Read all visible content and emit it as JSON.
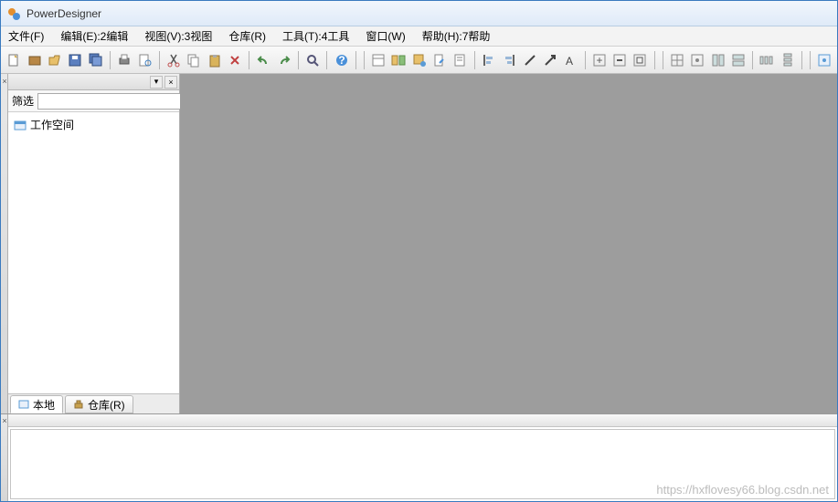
{
  "app": {
    "title": "PowerDesigner"
  },
  "menu": {
    "file": "文件(F)",
    "edit": "编辑(E):2编辑",
    "view": "视图(V):3视图",
    "repo": "仓库(R)",
    "tools": "工具(T):4工具",
    "window": "窗口(W)",
    "help": "帮助(H):7帮助"
  },
  "sidebar": {
    "filter_label": "筛选",
    "filter_value": "",
    "tree": {
      "workspace": "工作空间"
    },
    "tabs": {
      "local": "本地",
      "repo": "仓库(R)"
    }
  },
  "watermark": "https://hxflovesy66.blog.csdn.net"
}
